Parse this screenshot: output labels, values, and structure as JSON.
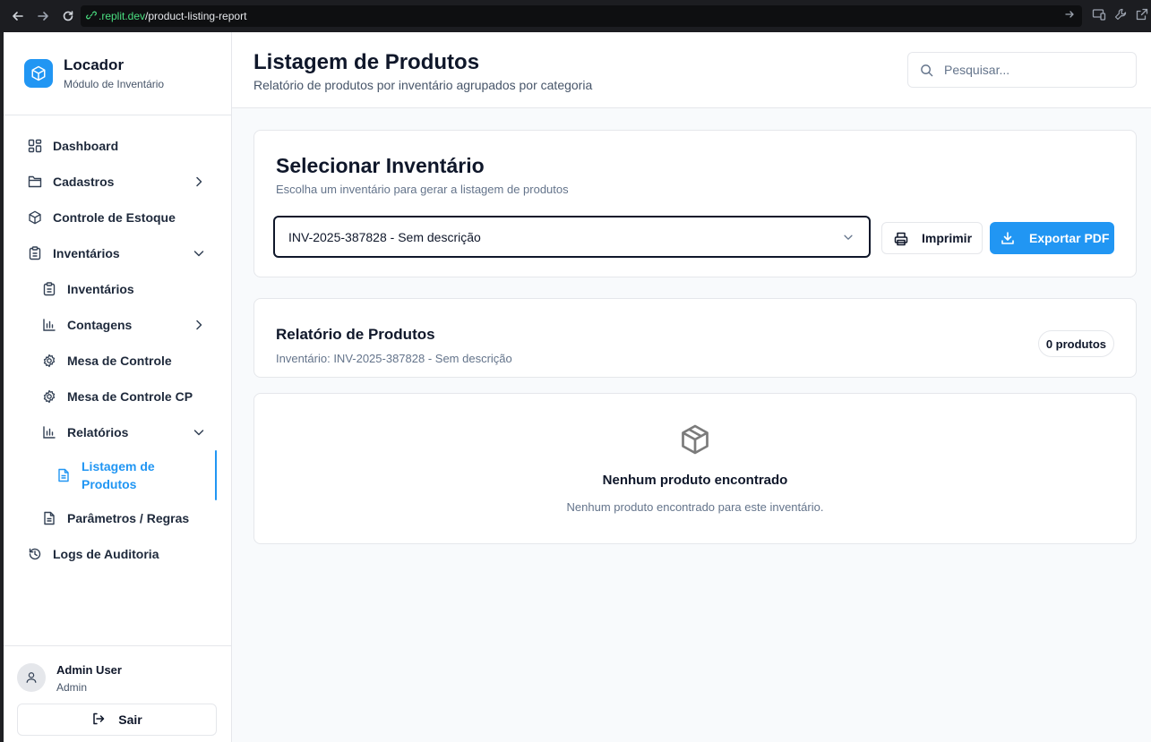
{
  "browser": {
    "url_host": ".replit.dev",
    "url_path": "/product-listing-report"
  },
  "brand": {
    "title": "Locador",
    "subtitle": "Módulo de Inventário"
  },
  "sidebar": {
    "items": [
      {
        "label": "Dashboard",
        "icon": "dashboard-icon"
      },
      {
        "label": "Cadastros",
        "icon": "folder-icon",
        "chevron": "right"
      },
      {
        "label": "Controle de Estoque",
        "icon": "box-icon"
      },
      {
        "label": "Inventários",
        "icon": "clipboard-icon",
        "chevron": "down"
      },
      {
        "label": "Inventários",
        "icon": "clipboard-icon"
      },
      {
        "label": "Contagens",
        "icon": "bar-chart-icon",
        "chevron": "right"
      },
      {
        "label": "Mesa de Controle",
        "icon": "gear-icon"
      },
      {
        "label": "Mesa de Controle CP",
        "icon": "gear-icon"
      },
      {
        "label": "Relatórios",
        "icon": "bar-chart-icon",
        "chevron": "down"
      },
      {
        "label": "Listagem de Produtos",
        "icon": "file-icon",
        "active": true
      },
      {
        "label": "Parâmetros / Regras",
        "icon": "file-icon"
      },
      {
        "label": "Logs de Auditoria",
        "icon": "history-icon"
      }
    ]
  },
  "user": {
    "name": "Admin User",
    "role": "Admin",
    "logout_label": "Sair"
  },
  "header": {
    "title": "Listagem de Produtos",
    "subtitle": "Relatório de produtos por inventário agrupados por categoria",
    "search_placeholder": "Pesquisar..."
  },
  "selector": {
    "title": "Selecionar Inventário",
    "description": "Escolha um inventário para gerar a listagem de produtos",
    "selected": "INV-2025-387828 - Sem descrição",
    "print_label": "Imprimir",
    "export_label": "Exportar PDF"
  },
  "report": {
    "title": "Relatório de Produtos",
    "inventory_line": "Inventário: INV-2025-387828 - Sem descrição",
    "count_badge": "0 produtos"
  },
  "empty": {
    "title": "Nenhum produto encontrado",
    "description": "Nenhum produto encontrado para este inventário."
  },
  "colors": {
    "accent": "#2196f3",
    "text": "#0f172a",
    "muted": "#64748b",
    "border": "#e5e7eb"
  }
}
